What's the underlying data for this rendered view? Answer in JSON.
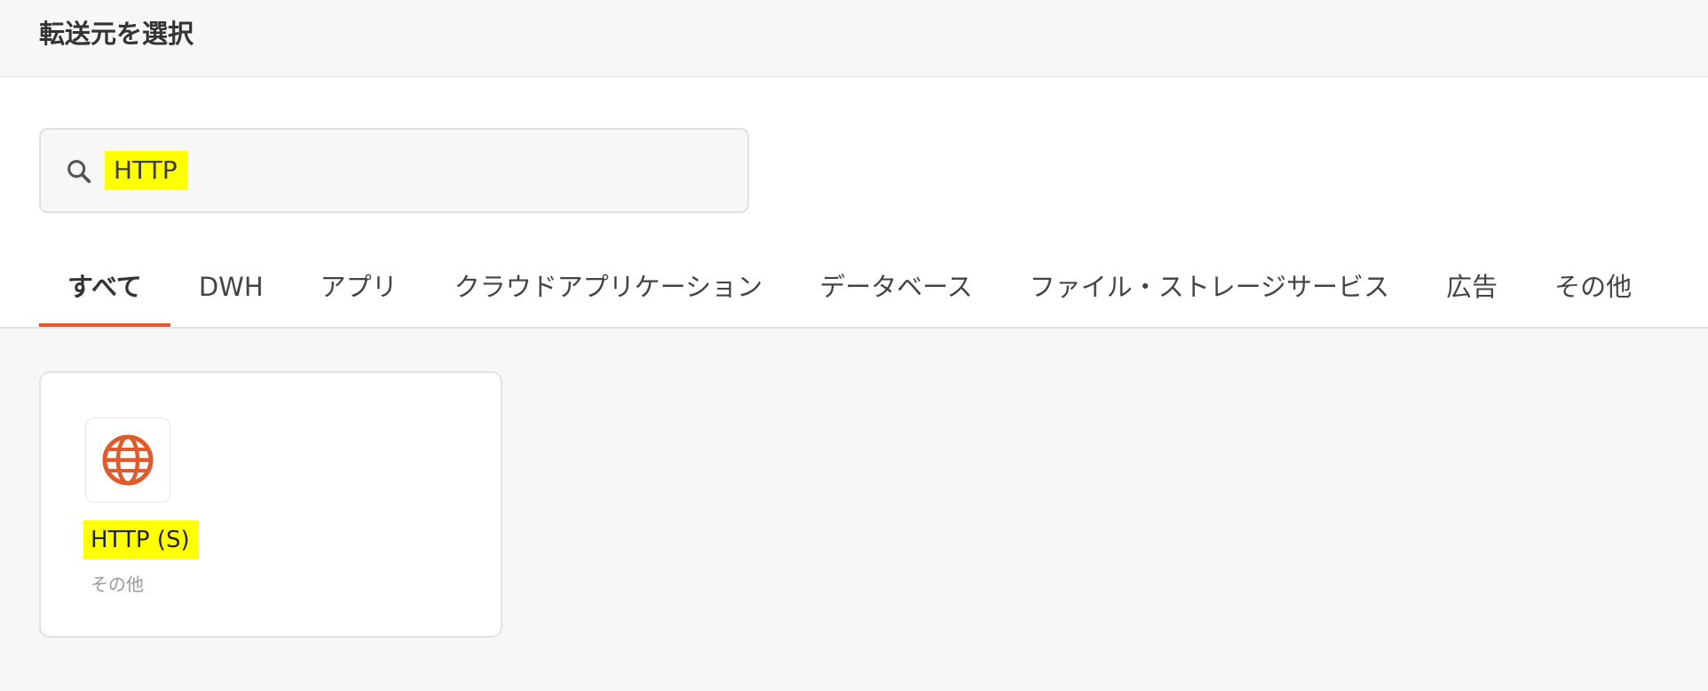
{
  "header": {
    "title": "転送元を選択"
  },
  "search": {
    "icon": "search-icon",
    "value": "HTTP"
  },
  "tabs": [
    {
      "label": "すべて",
      "active": true
    },
    {
      "label": "DWH",
      "active": false
    },
    {
      "label": "アプリ",
      "active": false
    },
    {
      "label": "クラウドアプリケーション",
      "active": false
    },
    {
      "label": "データベース",
      "active": false
    },
    {
      "label": "ファイル・ストレージサービス",
      "active": false
    },
    {
      "label": "広告",
      "active": false
    },
    {
      "label": "その他",
      "active": false
    }
  ],
  "results": [
    {
      "icon": "globe-icon",
      "title": "HTTP (S)",
      "category": "その他"
    }
  ],
  "colors": {
    "accent": "#e05a2b",
    "highlight": "#ffff00",
    "background": "#f7f7f7",
    "panel": "#ffffff"
  }
}
